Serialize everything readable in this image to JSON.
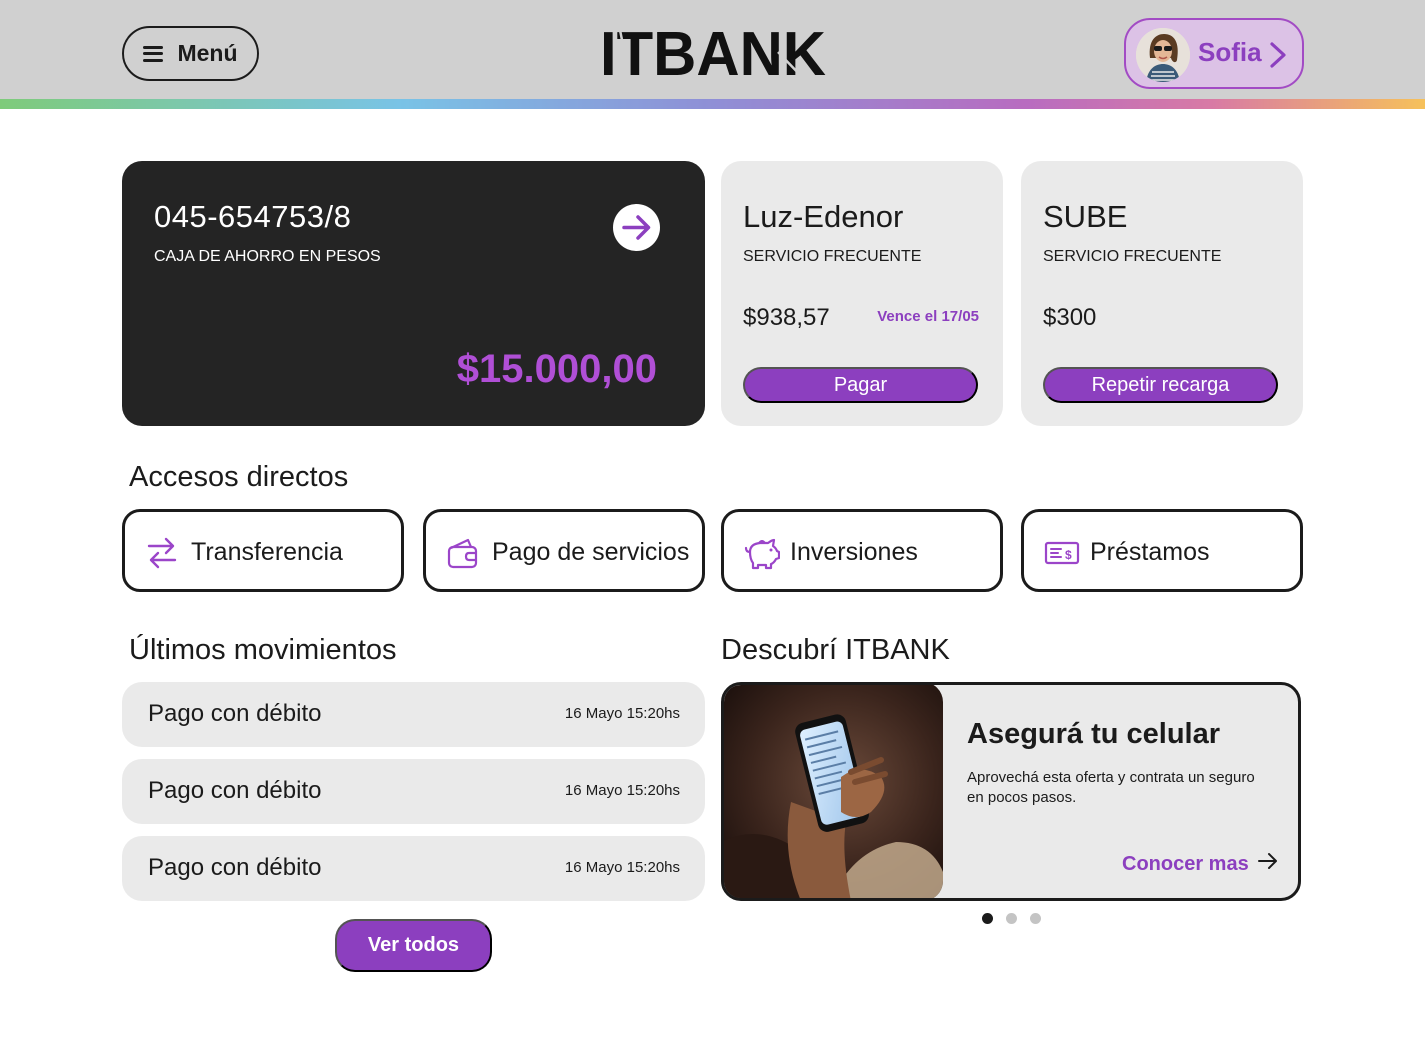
{
  "header": {
    "menu_label": "Menú",
    "logo_text": "ITBANK",
    "user_name": "Sofia"
  },
  "account": {
    "number": "045-654753/8",
    "type": "CAJA DE AHORRO EN PESOS",
    "balance": "$15.000,00"
  },
  "services": [
    {
      "name": "Luz-Edenor",
      "type": "SERVICIO FRECUENTE",
      "amount": "$938,57",
      "due": "Vence el 17/05",
      "button": "Pagar"
    },
    {
      "name": "SUBE",
      "type": "SERVICIO FRECUENTE",
      "amount": "$300",
      "due": "",
      "button": "Repetir recarga"
    }
  ],
  "shortcuts": {
    "title": "Accesos directos",
    "items": [
      {
        "label": "Transferencia",
        "icon": "transfer-icon"
      },
      {
        "label": "Pago de servicios",
        "icon": "wallet-icon"
      },
      {
        "label": "Inversiones",
        "icon": "piggy-bank-icon"
      },
      {
        "label": "Préstamos",
        "icon": "loan-icon"
      }
    ]
  },
  "movements": {
    "title": "Últimos movimientos",
    "items": [
      {
        "description": "Pago con débito",
        "date": "16 Mayo 15:20hs"
      },
      {
        "description": "Pago con débito",
        "date": "16 Mayo 15:20hs"
      },
      {
        "description": "Pago con débito",
        "date": "16 Mayo 15:20hs"
      }
    ],
    "view_all": "Ver todos"
  },
  "discover": {
    "title": "Descubrí ITBANK",
    "promo_title": "Asegurá tu celular",
    "promo_text": "Aprovechá esta oferta y contrata un seguro en pocos pasos.",
    "promo_link": "Conocer mas",
    "active_slide": 1,
    "total_slides": 3
  },
  "colors": {
    "accent": "#8c3fbf",
    "balance": "#b04fd6",
    "card_dark": "#242424",
    "card_light": "#eaeaea",
    "header_bg": "#d0d0d0"
  }
}
